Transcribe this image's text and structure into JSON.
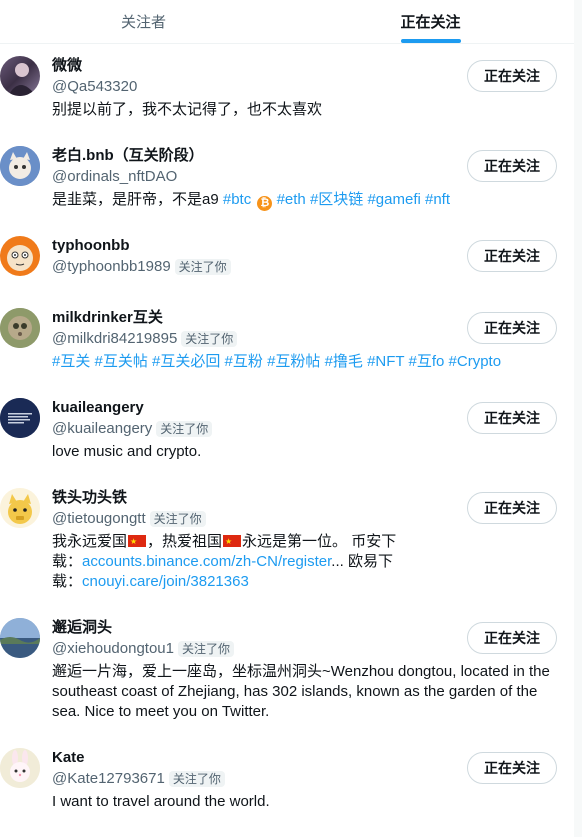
{
  "tabs": [
    {
      "label": "关注者",
      "active": false
    },
    {
      "label": "正在关注",
      "active": true
    }
  ],
  "follow_button_label": "正在关注",
  "follows_you_label": "关注了你",
  "users": [
    {
      "name": "微微",
      "handle": "@Qa543320",
      "bio": "别提以前了，我不太记得了，也不太喜欢"
    },
    {
      "name": "老白.bnb（互关阶段）",
      "handle": "@ordinals_nftDAO",
      "bio_text": "是韭菜，是肝帝，不是a9 ",
      "bio_tags": [
        "#btc",
        "#eth",
        "#区块链",
        "#gamefi",
        "#nft"
      ]
    },
    {
      "name": "typhoonbb",
      "handle": "@typhoonbb1989"
    },
    {
      "name": "milkdrinker互关",
      "handle": "@milkdri84219895",
      "bio_tags": [
        "#互关",
        "#互关帖",
        "#互关必回",
        "#互粉",
        "#互粉帖",
        "#撸毛",
        "#NFT",
        "#互fo",
        "#Crypto"
      ]
    },
    {
      "name": "kuaileangery",
      "handle": "@kuaileangery",
      "bio": "love music and crypto."
    },
    {
      "name": "铁头功头铁",
      "handle": "@tietougongtt",
      "bio_part1": "我永远爱国",
      "bio_part2": "，热爱祖国",
      "bio_part3": "永远是第一位。 币安下载：",
      "bio_link1": "accounts.binance.com/zh-CN/register",
      "bio_part4": "... 欧易下载：",
      "bio_link2": "cnouyi.care/join/3821363"
    },
    {
      "name": "邂逅洞头",
      "handle": "@xiehoudongtou1",
      "bio": "邂逅一片海，爱上一座岛，坐标温州洞头~Wenzhou dongtou, located in the southeast coast of Zhejiang, has 302 islands, known as the garden of the sea. Nice to meet you on Twitter."
    },
    {
      "name": "Kate",
      "handle": "@Kate12793671",
      "bio": "I want to travel around the world."
    }
  ],
  "colors": {
    "accent": "#1d9bf0",
    "text": "#0f1419",
    "secondary": "#536471",
    "border": "#cfd9de"
  }
}
